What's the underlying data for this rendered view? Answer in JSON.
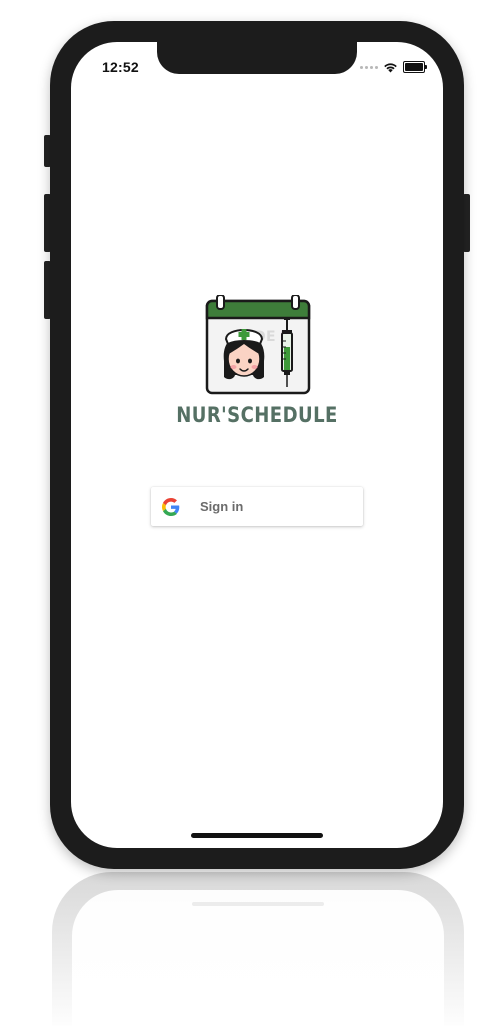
{
  "status_bar": {
    "time": "12:52",
    "icons": [
      "signal-dots-icon",
      "wifi-icon",
      "battery-icon"
    ]
  },
  "app": {
    "title": "NUR'SCHEDULE",
    "logo_icon": "nurse-calendar-icon",
    "logo_lettering": "TDEL"
  },
  "signin": {
    "label": "Sign in",
    "provider_icon": "google-icon"
  },
  "colors": {
    "title": "#557064",
    "calendar_header": "#3e7d3a",
    "phone_frame": "#1c1c1c",
    "google_blue": "#4285F4",
    "google_red": "#EA4335",
    "google_yellow": "#FBBC05",
    "google_green": "#34A853"
  }
}
